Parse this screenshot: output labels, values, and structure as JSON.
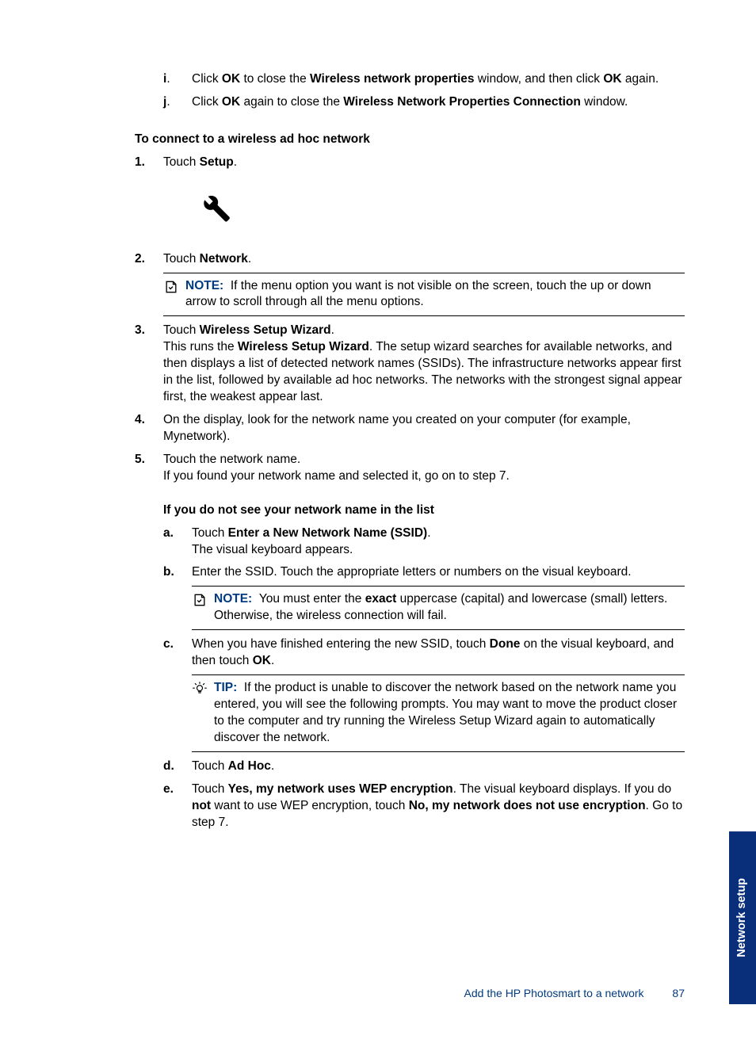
{
  "top_list": {
    "i": {
      "marker": "i",
      "pre": "Click ",
      "b1": "OK",
      "mid1": " to close the ",
      "b2": "Wireless network properties",
      "mid2": " window, and then click ",
      "b3": "OK",
      "post": " again."
    },
    "j": {
      "marker": "j",
      "pre": "Click ",
      "b1": "OK",
      "mid1": " again to close the ",
      "b2": "Wireless Network Properties Connection",
      "post": " window."
    }
  },
  "section_head": "To connect to a wireless ad hoc network",
  "steps": {
    "s1": {
      "marker": "1.",
      "pre": "Touch ",
      "b1": "Setup",
      "post": "."
    },
    "s2": {
      "marker": "2.",
      "pre": "Touch ",
      "b1": "Network",
      "post": ".",
      "note": {
        "label": "NOTE:",
        "text": "If the menu option you want is not visible on the screen, touch the up or down arrow to scroll through all the menu options."
      }
    },
    "s3": {
      "marker": "3.",
      "pre": "Touch ",
      "b1": "Wireless Setup Wizard",
      "post": ".",
      "para_pre": "This runs the ",
      "para_b1": "Wireless Setup Wizard",
      "para_post": ". The setup wizard searches for available networks, and then displays a list of detected network names (SSIDs). The infrastructure networks appear first in the list, followed by available ad hoc networks. The networks with the strongest signal appear first, the weakest appear last."
    },
    "s4": {
      "marker": "4.",
      "text": "On the display, look for the network name you created on your computer (for example, Mynetwork)."
    },
    "s5": {
      "marker": "5.",
      "line1": "Touch the network name.",
      "line2": "If you found your network name and selected it, go on to step 7."
    }
  },
  "sub_head": "If you do not see your network name in the list",
  "sub": {
    "a": {
      "marker": "a",
      "pre": "Touch ",
      "b1": "Enter a New Network Name (SSID)",
      "post": ".",
      "line2": "The visual keyboard appears."
    },
    "b": {
      "marker": "b",
      "text": "Enter the SSID. Touch the appropriate letters or numbers on the visual keyboard.",
      "note": {
        "label": "NOTE:",
        "pre": "You must enter the ",
        "b1": "exact",
        "post": " uppercase (capital) and lowercase (small) letters. Otherwise, the wireless connection will fail."
      }
    },
    "c": {
      "marker": "c",
      "pre": "When you have finished entering the new SSID, touch ",
      "b1": "Done",
      "mid": " on the visual keyboard, and then touch ",
      "b2": "OK",
      "post": ".",
      "tip": {
        "label": "TIP:",
        "text": "If the product is unable to discover the network based on the network name you entered, you will see the following prompts. You may want to move the product closer to the computer and try running the Wireless Setup Wizard again to automatically discover the network."
      }
    },
    "d": {
      "marker": "d",
      "pre": "Touch ",
      "b1": "Ad Hoc",
      "post": "."
    },
    "e": {
      "marker": "e",
      "pre": "Touch ",
      "b1": "Yes, my network uses WEP encryption",
      "mid1": ". The visual keyboard displays. If you do ",
      "b2": "not",
      "mid2": " want to use WEP encryption, touch ",
      "b3": "No, my network does not use encryption",
      "post": ". Go to step 7."
    }
  },
  "footer": {
    "link": "Add the HP Photosmart to a network",
    "page": "87"
  },
  "side_tab": "Network setup"
}
